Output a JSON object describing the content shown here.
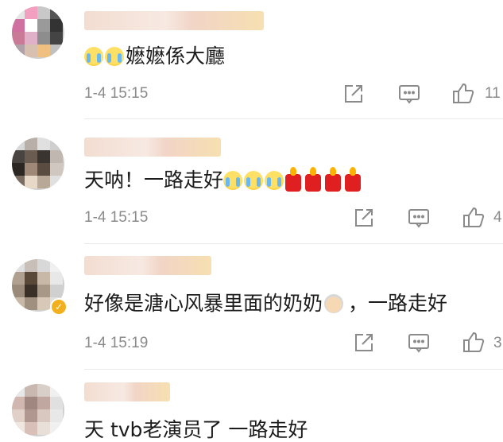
{
  "comments": [
    {
      "text_prefix_emojis": [
        "cry-emoji",
        "cry-emoji"
      ],
      "text": "嬷嬷係大廳",
      "time": "1-4 15:15",
      "likes": "11",
      "suffix_emojis": []
    },
    {
      "text": "天呐！一路走好",
      "time": "1-4 15:15",
      "likes": "4",
      "suffix_emojis": [
        "cry-emoji",
        "cry-emoji",
        "cry-emoji",
        "candle-emoji",
        "candle-emoji",
        "candle-emoji",
        "candle-emoji"
      ]
    },
    {
      "text": "好像是溏心风暴里面的奶奶",
      "text_after_emoji": "，一路走好",
      "time": "1-4 15:19",
      "likes": "3",
      "inline_emoji": "grandma-emoji",
      "verified_badge": "✓"
    },
    {
      "text": "天 tvb老演员了 一路走好"
    }
  ],
  "icons": {
    "share": "share-icon",
    "comment": "comment-icon",
    "like": "thumbs-up-icon"
  },
  "colors": {
    "text": "#1c1c1c",
    "meta": "#8a8a8a",
    "badge": "#f2b01e"
  }
}
